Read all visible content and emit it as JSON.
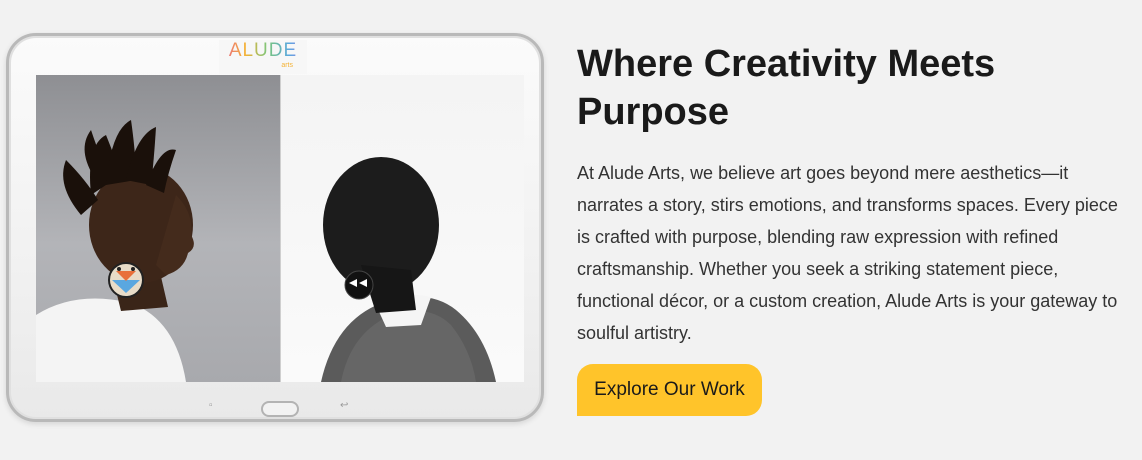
{
  "tablet": {
    "logo": {
      "word": "ALUDE",
      "sub": "arts"
    },
    "photo": {
      "description": ""
    }
  },
  "section": {
    "heading": "Where Creativity Meets Purpose",
    "body": "At Alude Arts, we believe art goes beyond mere aesthetics—it narrates a story, stirs emotions, and transforms spaces. Every piece is crafted with purpose, blending raw expression with refined craftsmanship. Whether you seek a striking statement piece, functional décor, or a custom creation, Alude Arts is your gateway to soulful artistry.",
    "cta_label": "Explore Our Work"
  },
  "colors": {
    "background": "#f2f2f2",
    "cta": "#ffc42a",
    "heading": "#1a1a1a",
    "body": "#333333"
  },
  "icons": [
    "recent-apps-icon",
    "home-button-icon",
    "back-icon"
  ]
}
